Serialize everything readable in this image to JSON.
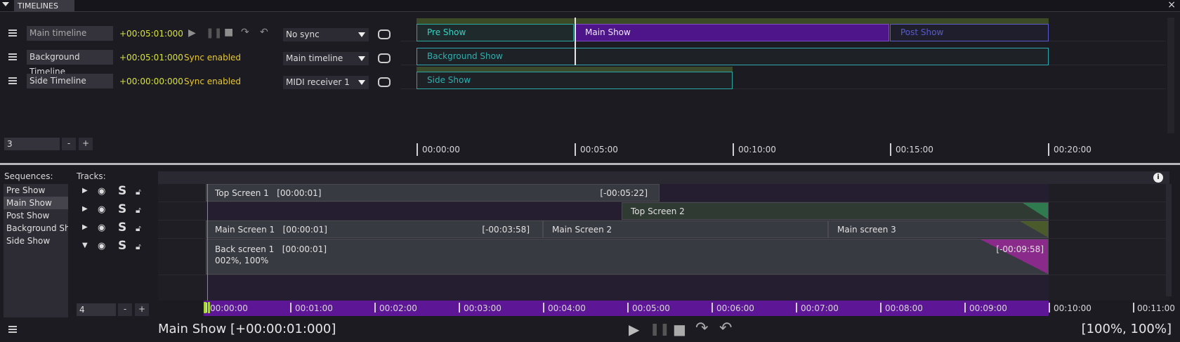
{
  "window": {
    "tab": "TIMELINES",
    "close": "×"
  },
  "timelines": [
    {
      "name": "Main timeline",
      "time": "+00:05:01:000",
      "sync_status": "",
      "sync_select": "No sync"
    },
    {
      "name": "Background Timeline",
      "time": "+00:05:01:000",
      "sync_status": "Sync enabled",
      "sync_select": "Main timeline"
    },
    {
      "name": "Side Timeline",
      "time": "+00:00:00:000",
      "sync_status": "Sync enabled",
      "sync_select": "MIDI receiver 1"
    }
  ],
  "timeline_count": "3",
  "timeline_clips": {
    "pre_show": "Pre Show",
    "main_show": "Main Show",
    "post_show": "Post Show",
    "background_show": "Background Show",
    "side_show": "Side Show"
  },
  "top_ruler": [
    "00:00:00",
    "00:05:00",
    "00:10:00",
    "00:15:00",
    "00:20:00"
  ],
  "sequences": {
    "label": "Sequences:",
    "items": [
      "Pre Show",
      "Main Show",
      "Post Show",
      "Background Show",
      "Side Show"
    ],
    "selected": "Main Show"
  },
  "tracks": {
    "label": "Tracks:",
    "count": "4",
    "solo_letter": "S"
  },
  "stepper": {
    "minus": "-",
    "plus": "+"
  },
  "clips": {
    "top_screen_1": {
      "name": "Top Screen 1",
      "start": "[00:00:01]",
      "remaining": "[-00:05:22]"
    },
    "top_screen_2": {
      "name": "Top Screen 2"
    },
    "main_screen_1": {
      "name": "Main Screen 1",
      "start": "[00:00:01]",
      "remaining": "[-00:03:58]"
    },
    "main_screen_2": {
      "name": "Main Screen 2"
    },
    "main_screen_3": {
      "name": "Main screen 3"
    },
    "back_screen_1": {
      "name": "Back screen 1",
      "start": "[00:00:01]",
      "remaining": "[-00:09:58]",
      "values": "002%, 100%"
    }
  },
  "bottom_ruler": [
    "00:00:00",
    "00:01:00",
    "00:02:00",
    "00:03:00",
    "00:04:00",
    "00:05:00",
    "00:06:00",
    "00:07:00",
    "00:08:00",
    "00:09:00",
    "00:10:00",
    "00:11:00"
  ],
  "status": {
    "title": "Main Show [+00:00:01:000]",
    "zoom": "[100%, 100%]"
  },
  "colors": {
    "accent": "#5c1696",
    "green": "#3a8a3a",
    "cyan": "#2fb0b0",
    "time": "#d6e23c",
    "sync": "#e8c82b"
  }
}
